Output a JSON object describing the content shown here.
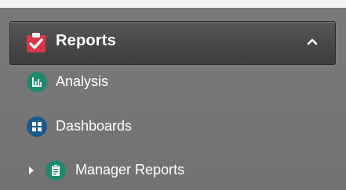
{
  "sidebar": {
    "section": {
      "title": "Reports",
      "icon": "clipboard-check-icon",
      "expanded": true,
      "toggle_icon": "chevron-up-icon"
    },
    "items": [
      {
        "label": "Analysis",
        "icon": "bar-chart-icon",
        "has_children": false
      },
      {
        "label": "Dashboards",
        "icon": "dashboard-grid-icon",
        "has_children": false
      },
      {
        "label": "Manager Reports",
        "icon": "clipboard-list-icon",
        "has_children": true,
        "expand_icon": "caret-right-icon"
      }
    ]
  },
  "colors": {
    "panel_background": "#757575",
    "header_background": "#454545",
    "section_icon": "#d9364a",
    "item_icon": "#1f8a6b",
    "dashboards_icon": "#1a5a8a",
    "text": "#ffffff"
  }
}
